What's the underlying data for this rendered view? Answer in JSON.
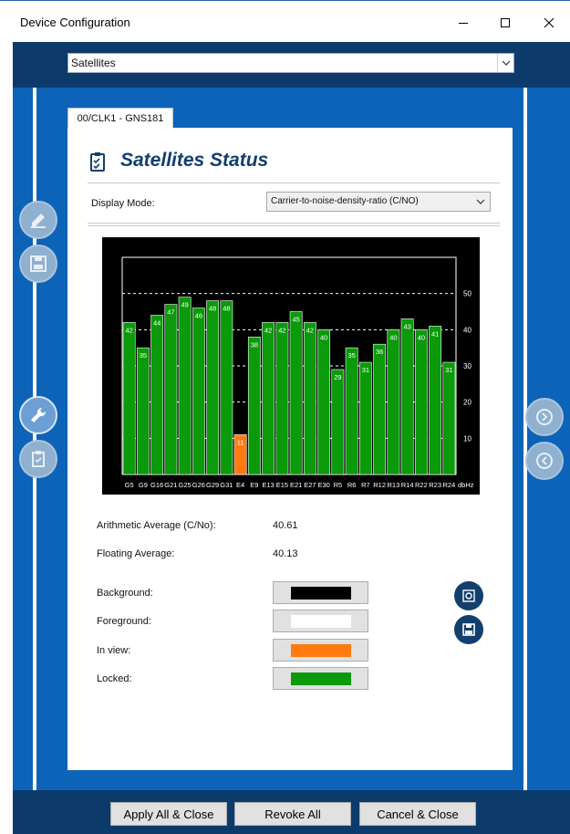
{
  "window": {
    "title": "Device Configuration"
  },
  "selector": {
    "value": "Satellites"
  },
  "tab": {
    "label": "00/CLK1 - GNS181"
  },
  "panel": {
    "title": "Satellites Status",
    "display_mode_label": "Display Mode:",
    "display_mode_value": "Carrier-to-noise-density-ratio (C/NO)"
  },
  "stats": {
    "arith_label": "Arithmetic Average (C/No):",
    "arith_value": "40.61",
    "floating_label": "Floating Average:",
    "floating_value": "40.13"
  },
  "colors": {
    "background_label": "Background:",
    "foreground_label": "Foreground:",
    "inview_label": "In view:",
    "locked_label": "Locked:",
    "background": "#000000",
    "foreground": "#ffffff",
    "inview": "#ff7a0f",
    "locked": "#0a9a0a"
  },
  "footer": {
    "apply": "Apply All & Close",
    "revoke": "Revoke All",
    "cancel": "Cancel & Close"
  },
  "chart_data": {
    "type": "bar",
    "categories": [
      "G5",
      "G9",
      "G16",
      "G21",
      "G25",
      "G26",
      "G29",
      "G31",
      "E4",
      "E9",
      "E13",
      "E15",
      "E21",
      "E27",
      "E30",
      "R5",
      "R6",
      "R7",
      "R12",
      "R13",
      "R14",
      "R22",
      "R23",
      "R24"
    ],
    "values": [
      42,
      35,
      44,
      47,
      49,
      46,
      48,
      48,
      11,
      38,
      42,
      42,
      45,
      42,
      40,
      29,
      35,
      31,
      36,
      40,
      43,
      40,
      41,
      31
    ],
    "status": [
      "locked",
      "locked",
      "locked",
      "locked",
      "locked",
      "locked",
      "locked",
      "locked",
      "inview",
      "locked",
      "locked",
      "locked",
      "locked",
      "locked",
      "locked",
      "locked",
      "locked",
      "locked",
      "locked",
      "locked",
      "locked",
      "locked",
      "locked",
      "locked"
    ],
    "unit": "dbHz",
    "yticks": [
      10,
      20,
      30,
      40,
      50
    ],
    "ylim": [
      0,
      60
    ],
    "grid": true
  }
}
